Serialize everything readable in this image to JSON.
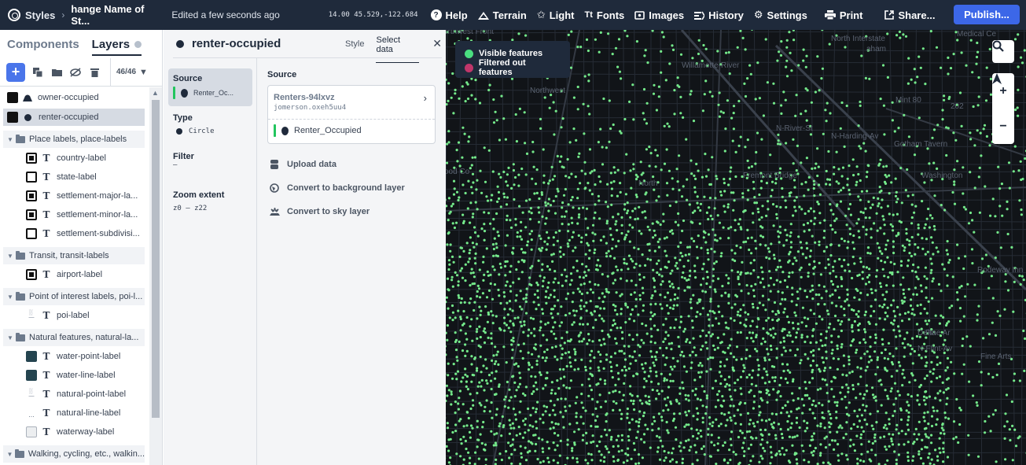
{
  "topbar": {
    "styles_label": "Styles",
    "style_name": "hange Name of St...",
    "edited": "Edited a few seconds ago",
    "coords": "14.00 45.529,-122.684",
    "menu": [
      {
        "label": "Help",
        "icon": "question-circle-icon"
      },
      {
        "label": "Terrain",
        "icon": "mountain-icon"
      },
      {
        "label": "Light",
        "icon": "sun-icon"
      },
      {
        "label": "Fonts",
        "icon": "text-size-icon"
      },
      {
        "label": "Images",
        "icon": "image-icon"
      },
      {
        "label": "History",
        "icon": "history-icon"
      },
      {
        "label": "Settings",
        "icon": "gear-icon"
      },
      {
        "label": "Print",
        "icon": "printer-icon"
      },
      {
        "label": "Share...",
        "icon": "share-icon"
      }
    ],
    "publish": "Publish..."
  },
  "left": {
    "tabs": {
      "components": "Components",
      "layers": "Layers"
    },
    "count": "46/46",
    "layers": [
      {
        "label": "owner-occupied",
        "kind": "layer",
        "icon": "fill-icon",
        "swatch": "black"
      },
      {
        "label": "renter-occupied",
        "kind": "layer",
        "icon": "circle-icon",
        "swatch": "black",
        "selected": true
      },
      {
        "label": "Place labels, place-labels",
        "kind": "group"
      },
      {
        "label": "country-label",
        "kind": "child",
        "swatch": "blackring"
      },
      {
        "label": "state-label",
        "kind": "child",
        "swatch": "outline"
      },
      {
        "label": "settlement-major-la...",
        "kind": "child",
        "swatch": "blackring"
      },
      {
        "label": "settlement-minor-la...",
        "kind": "child",
        "swatch": "blackring"
      },
      {
        "label": "settlement-subdivisi...",
        "kind": "child",
        "swatch": "outline"
      },
      {
        "label": "Transit, transit-labels",
        "kind": "group"
      },
      {
        "label": "airport-label",
        "kind": "child",
        "swatch": "blackring"
      },
      {
        "label": "Point of interest labels, poi-l...",
        "kind": "group"
      },
      {
        "label": "poi-label",
        "kind": "child",
        "swatch": "fade"
      },
      {
        "label": "Natural features, natural-la...",
        "kind": "group"
      },
      {
        "label": "water-point-label",
        "kind": "child",
        "swatch": "teal"
      },
      {
        "label": "water-line-label",
        "kind": "child",
        "swatch": "teal"
      },
      {
        "label": "natural-point-label",
        "kind": "child",
        "swatch": "fade"
      },
      {
        "label": "natural-line-label",
        "kind": "child",
        "swatch": "none"
      },
      {
        "label": "waterway-label",
        "kind": "child",
        "swatch": "light"
      },
      {
        "label": "Walking, cycling, etc., walkin...",
        "kind": "group"
      }
    ]
  },
  "mid": {
    "title": "renter-occupied",
    "tab_style": "Style",
    "tab_select": "Select data",
    "source_label": "Source",
    "source_value": "Renter_Oc...",
    "type_label": "Type",
    "type_value": "Circle",
    "filter_label": "Filter",
    "filter_value": "—",
    "zoom_label": "Zoom extent",
    "zoom_value": "z0 – z22",
    "right_source_label": "Source",
    "tileset_name": "Renters-94lxvz",
    "tileset_id": "jomerson.oxeh5uu4",
    "source_layer": "Renter_Occupied",
    "actions": [
      {
        "label": "Upload data",
        "icon": "database-icon"
      },
      {
        "label": "Convert to background layer",
        "icon": "globe-icon"
      },
      {
        "label": "Convert to sky layer",
        "icon": "sky-icon"
      }
    ]
  },
  "map": {
    "legend": [
      {
        "label": "Visible features",
        "color": "#4ade80"
      },
      {
        "label": "Filtered out features",
        "color": "#c0366a"
      }
    ],
    "labels": [
      "orthwest Front",
      "North Interstate",
      "aham",
      "Medical Ce",
      "Northwest",
      "Willamette-River",
      "Mint 80",
      "202",
      "N-River-St",
      "N-Harding-Av",
      "Gotham Tavern",
      "ood Co",
      "Fremont Bridge",
      "Washington",
      "North",
      "Rodeway Inn",
      "Delta",
      "Fine Ar",
      "Fine Arts",
      "N-Flint-Av"
    ],
    "dot_color": "#74e88a"
  }
}
